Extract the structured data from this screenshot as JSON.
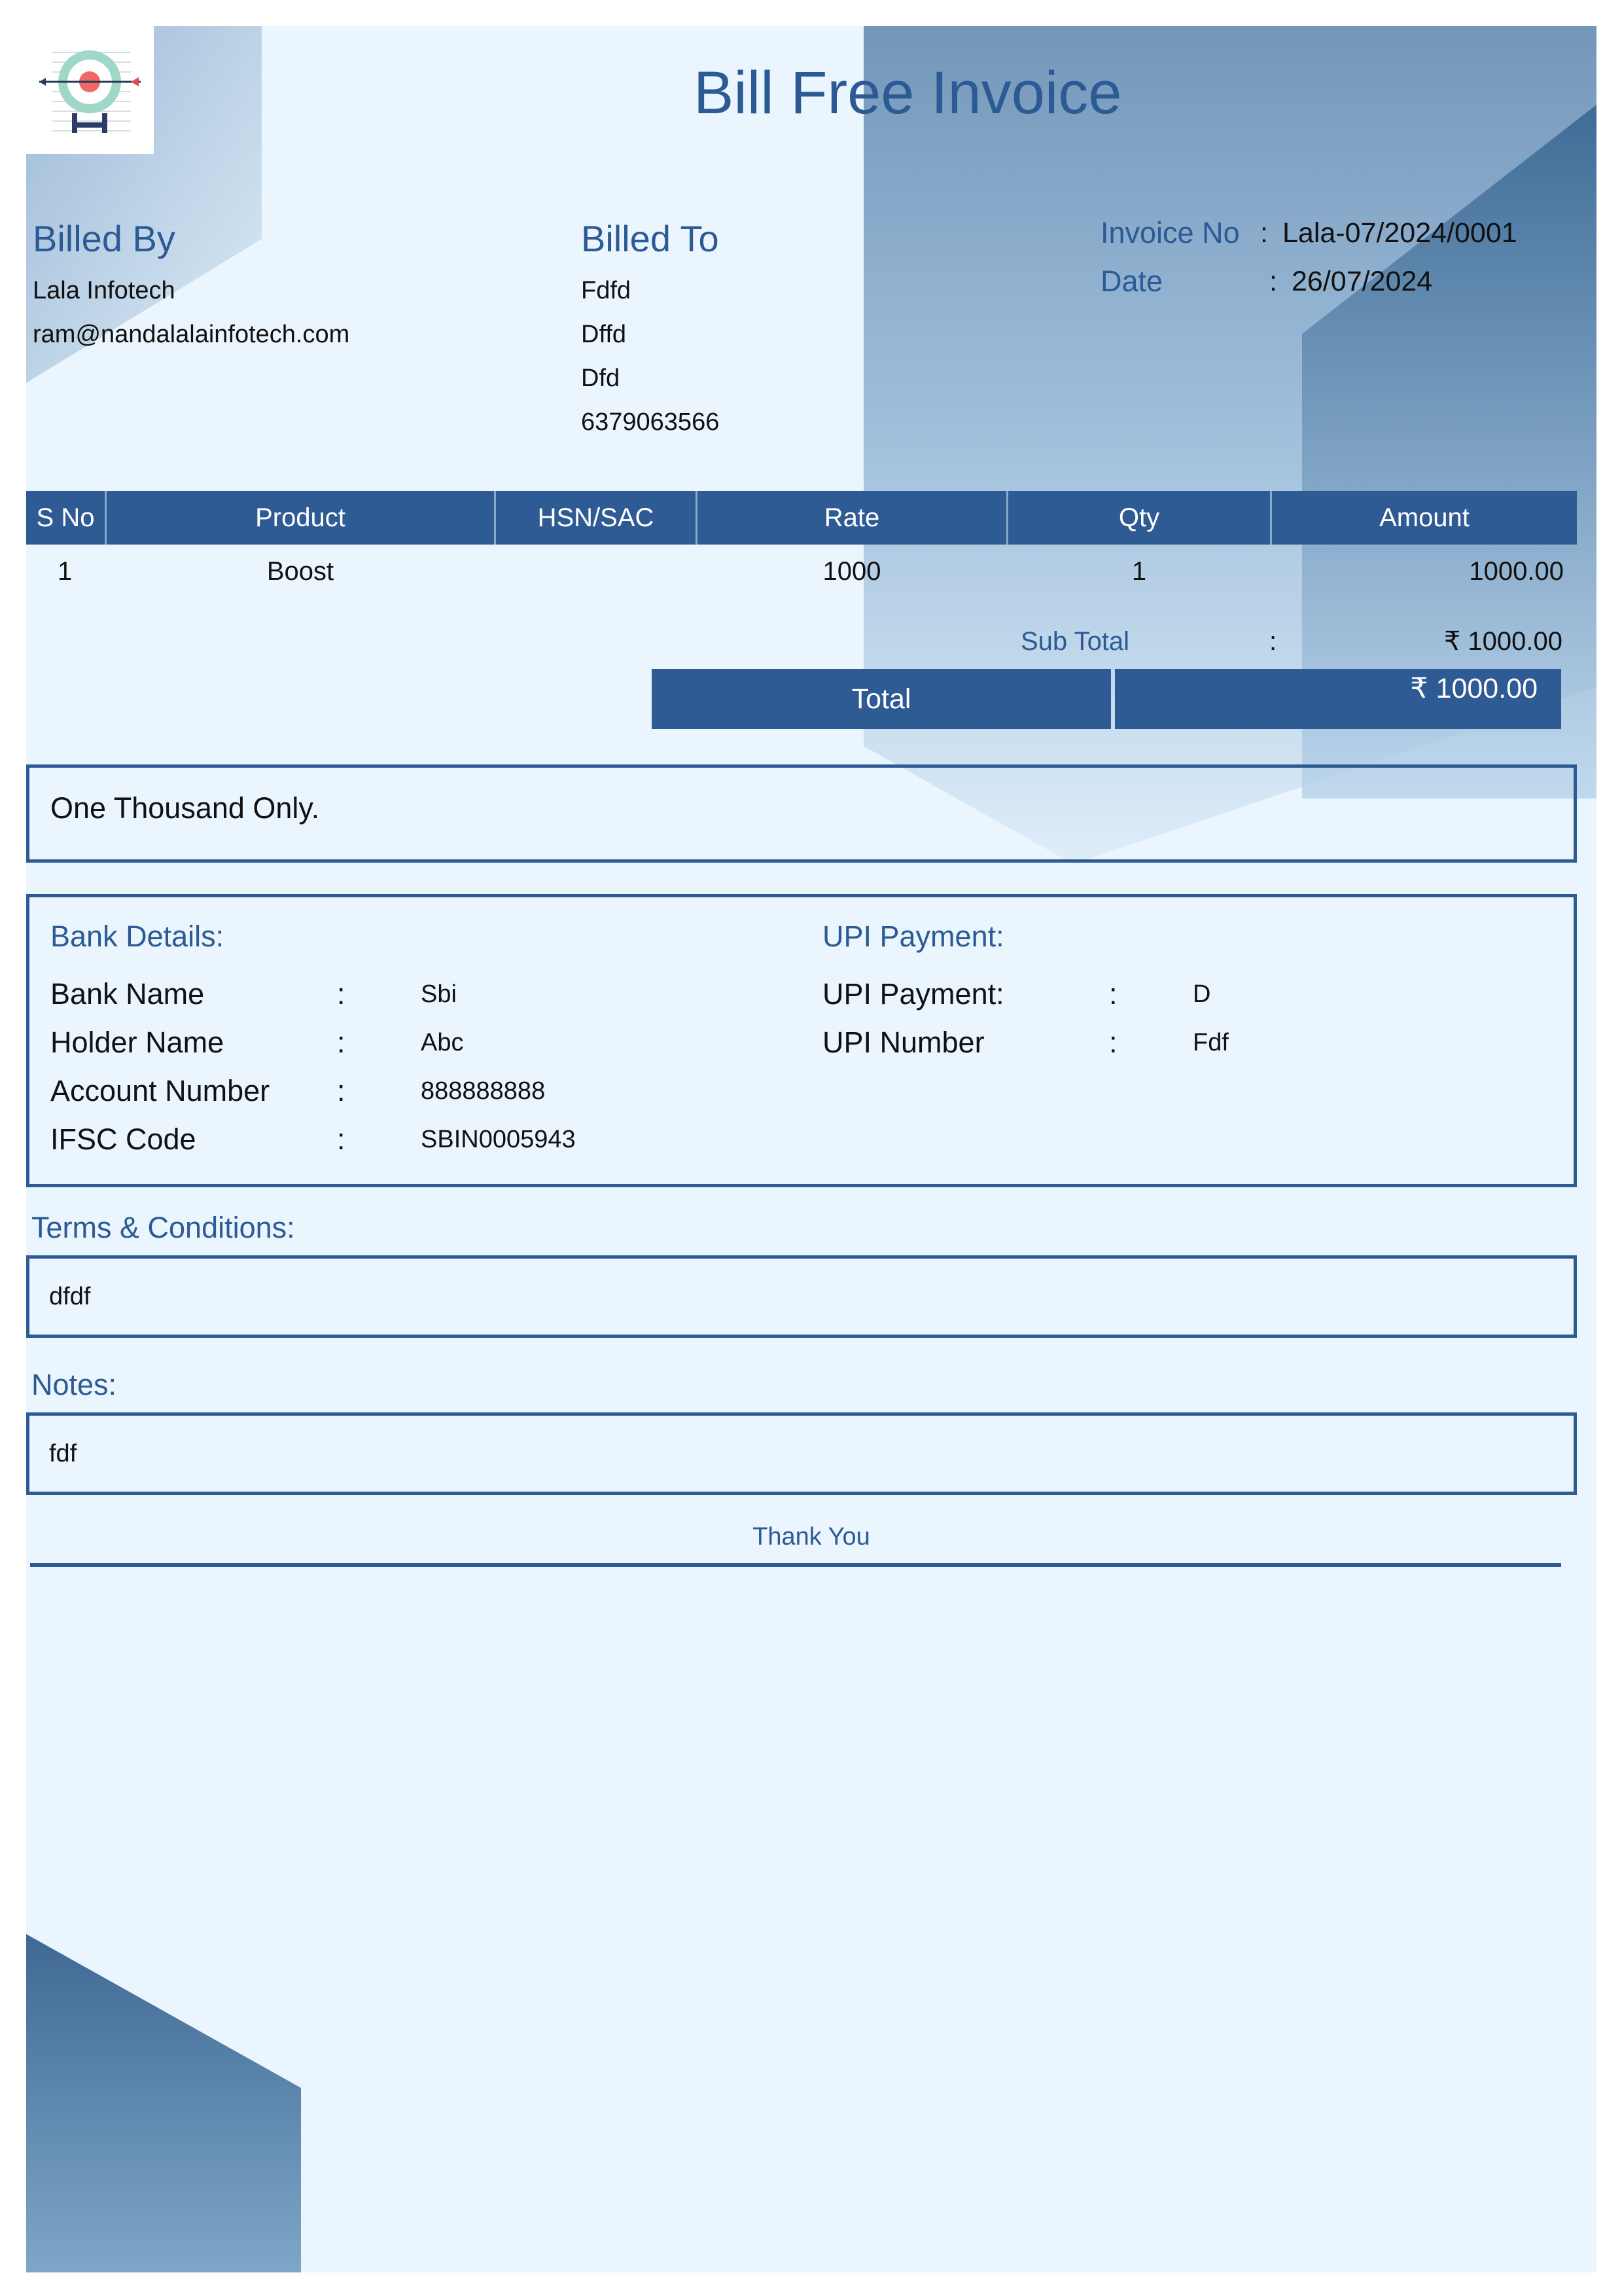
{
  "title": "Bill Free Invoice",
  "colors": {
    "accent": "#2f5b94",
    "background": "#eaf5fd"
  },
  "logo": {
    "icon": "target-arrow-icon"
  },
  "billed_by": {
    "heading": "Billed By",
    "name": "Lala Infotech",
    "email": "ram@nandalalainfotech.com"
  },
  "billed_to": {
    "heading": "Billed To",
    "lines": [
      "Fdfd",
      "Dffd",
      "Dfd",
      "6379063566"
    ]
  },
  "invoice_meta": {
    "invoice_no_label": "Invoice No",
    "invoice_no_sep": ":",
    "invoice_no": "Lala-07/2024/0001",
    "date_label": "Date",
    "date_sep": ":",
    "date": "26/07/2024"
  },
  "items_table": {
    "headers": [
      "S No",
      "Product",
      "HSN/SAC",
      "Rate",
      "Qty",
      "Amount"
    ],
    "rows": [
      {
        "sno": "1",
        "product": "Boost",
        "hsn": "",
        "rate": "1000",
        "qty": "1",
        "amount": "1000.00"
      }
    ]
  },
  "summary": {
    "subtotal_label": "Sub Total",
    "subtotal_sep": ":",
    "subtotal": "₹ 1000.00",
    "total_label": "Total",
    "total": "₹ 1000.00"
  },
  "amount_in_words": "One Thousand Only.",
  "bank_details": {
    "heading": "Bank Details:",
    "rows": [
      {
        "label": "Bank Name",
        "sep": ":",
        "value": "Sbi"
      },
      {
        "label": "Holder Name",
        "sep": ":",
        "value": "Abc"
      },
      {
        "label": "Account Number",
        "sep": ":",
        "value": "888888888"
      },
      {
        "label": "IFSC Code",
        "sep": ":",
        "value": "SBIN0005943"
      }
    ]
  },
  "upi": {
    "heading": "UPI Payment:",
    "rows": [
      {
        "label": "UPI Payment:",
        "sep": ":",
        "value": "D"
      },
      {
        "label": "UPI Number",
        "sep": ":",
        "value": "Fdf"
      }
    ]
  },
  "terms": {
    "heading": "Terms & Conditions:",
    "text": "dfdf"
  },
  "notes": {
    "heading": "Notes:",
    "text": "fdf"
  },
  "footer": {
    "thank_you": "Thank You"
  }
}
